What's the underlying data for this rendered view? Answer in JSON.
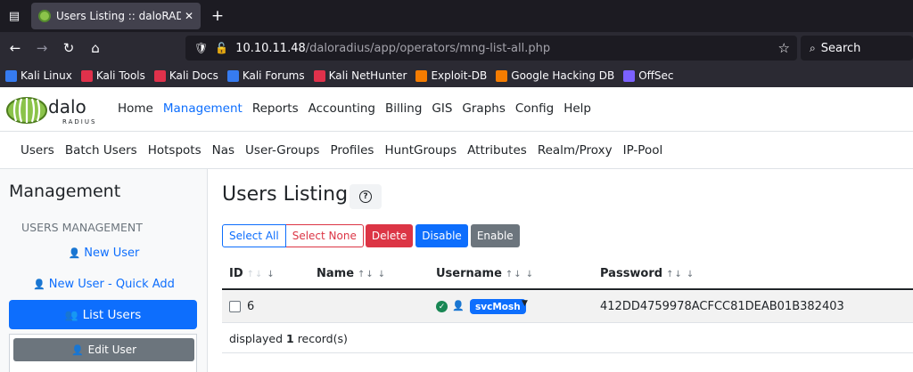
{
  "browser": {
    "tab_title": "Users Listing :: daloRADIUS",
    "url_host": "10.10.11.48",
    "url_path": "/daloradius/app/operators/mng-list-all.php",
    "search_placeholder": "Search",
    "bookmarks": [
      {
        "label": "Kali Linux",
        "icon": "kali-icon",
        "color": "#367bf0"
      },
      {
        "label": "Kali Tools",
        "icon": "kali-tools-icon",
        "color": "#e0314b"
      },
      {
        "label": "Kali Docs",
        "icon": "kali-docs-icon",
        "color": "#e0314b"
      },
      {
        "label": "Kali Forums",
        "icon": "kali-forums-icon",
        "color": "#367bf0"
      },
      {
        "label": "Kali NetHunter",
        "icon": "nethunter-icon",
        "color": "#e0314b"
      },
      {
        "label": "Exploit-DB",
        "icon": "exploit-db-icon",
        "color": "#f57c00"
      },
      {
        "label": "Google Hacking DB",
        "icon": "ghdb-icon",
        "color": "#f57c00"
      },
      {
        "label": "OffSec",
        "icon": "offsec-icon",
        "color": "#7b61ff"
      }
    ]
  },
  "app": {
    "logo_text": "dalo",
    "logo_sub": "RADIUS",
    "menu": [
      "Home",
      "Management",
      "Reports",
      "Accounting",
      "Billing",
      "GIS",
      "Graphs",
      "Config",
      "Help"
    ],
    "active_menu": "Management",
    "submenu": [
      "Users",
      "Batch Users",
      "Hotspots",
      "Nas",
      "User-Groups",
      "Profiles",
      "HuntGroups",
      "Attributes",
      "Realm/Proxy",
      "IP-Pool"
    ]
  },
  "sidebar": {
    "title": "Management",
    "section": "USERS MANAGEMENT",
    "new_user": "New User",
    "new_user_quick": "New User - Quick Add",
    "list_users": "List Users",
    "edit_user": "Edit User"
  },
  "main": {
    "title": "Users Listing",
    "buttons": {
      "select_all": "Select All",
      "select_none": "Select None",
      "delete": "Delete",
      "disable": "Disable",
      "enable": "Enable"
    },
    "columns": {
      "id": "ID",
      "name": "Name",
      "username": "Username",
      "password": "Password"
    },
    "rows": [
      {
        "id": "6",
        "name": "",
        "username": "svcMosh",
        "password": "412DD4759978ACFCC81DEAB01B382403"
      }
    ],
    "footer_prefix": "displayed",
    "footer_count": "1",
    "footer_suffix": "record(s)"
  },
  "colors": {
    "accent": "#0d6efd",
    "danger": "#dc3545",
    "secondary": "#6c757d",
    "success": "#198754"
  }
}
